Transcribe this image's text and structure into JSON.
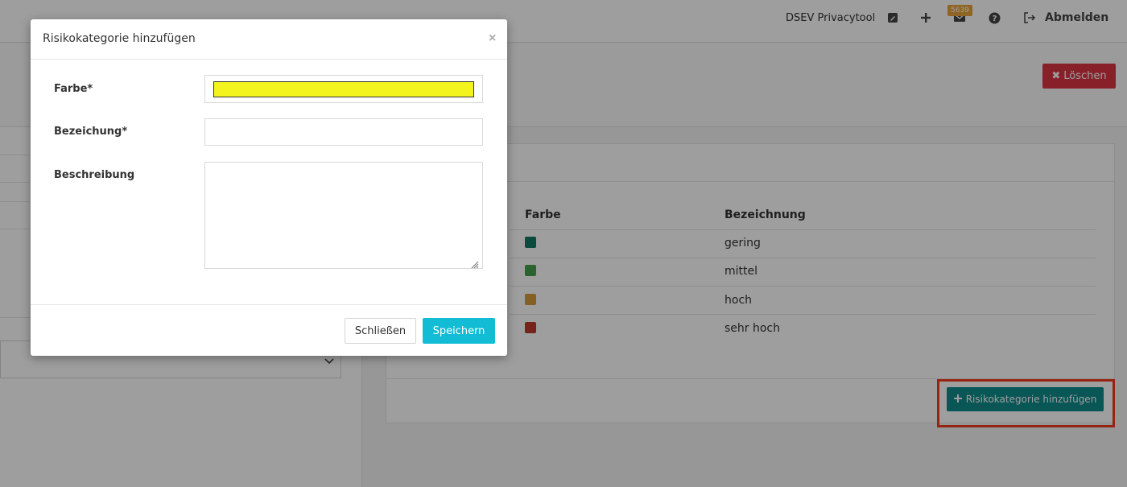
{
  "topbar": {
    "app_name": "DSEV Privacytool",
    "notifications_count": "5639",
    "logout_label": "Abmelden"
  },
  "header": {
    "delete_label": "Löschen"
  },
  "table": {
    "col_color": "Farbe",
    "col_name": "Bezeichnung",
    "rows": [
      {
        "color": "#117a65",
        "label": "gering"
      },
      {
        "color": "#45a049",
        "label": "mittel"
      },
      {
        "color": "#d89a3a",
        "label": "hoch"
      },
      {
        "color": "#c0392b",
        "label": "sehr hoch"
      }
    ]
  },
  "add_button_label": "Risikokategorie hinzufügen",
  "modal": {
    "title": "Risikokategorie hinzufügen",
    "close_symbol": "×",
    "color_label": "Farbe*",
    "color_value": "#f3f31e",
    "name_label": "Bezeichung*",
    "name_value": "",
    "description_label": "Beschreibung",
    "description_value": "",
    "close_button": "Schließen",
    "save_button": "Speichern"
  }
}
